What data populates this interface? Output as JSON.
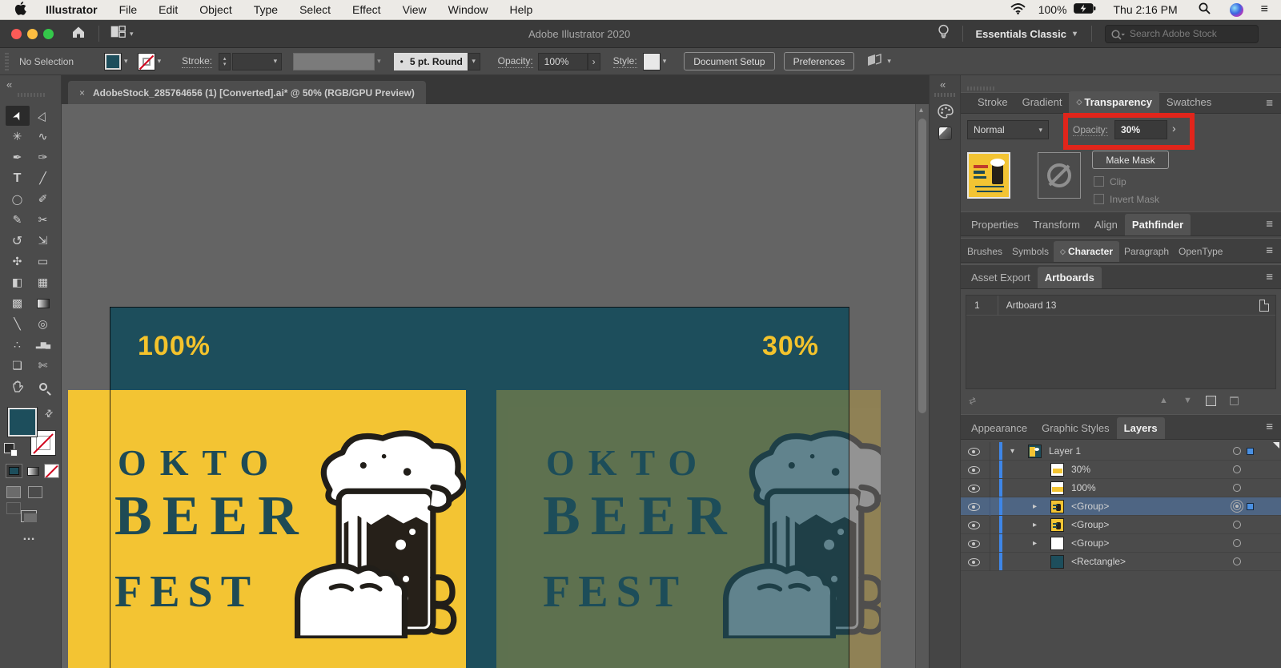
{
  "menubar": {
    "items": [
      "Illustrator",
      "File",
      "Edit",
      "Object",
      "Type",
      "Select",
      "Effect",
      "View",
      "Window",
      "Help"
    ],
    "status": {
      "battery": "100%",
      "clock": "Thu 2:16 PM"
    }
  },
  "titlebar": {
    "title": "Adobe Illustrator 2020",
    "workspace": "Essentials Classic",
    "search_placeholder": "Search Adobe Stock"
  },
  "controlbar": {
    "selection_status": "No Selection",
    "stroke_label": "Stroke:",
    "brush_preview": "5 pt. Round",
    "brush_bullet": "•",
    "opacity_label": "Opacity:",
    "opacity_value": "100%",
    "style_label": "Style:",
    "document_setup": "Document Setup",
    "preferences": "Preferences"
  },
  "document_tab": {
    "close": "×",
    "title": "AdobeStock_285764656 (1) [Converted].ai* @ 50% (RGB/GPU Preview)"
  },
  "tools": [
    {
      "name": "selection-tool",
      "glyph": "➤"
    },
    {
      "name": "direct-selection-tool",
      "glyph": "▷"
    },
    {
      "name": "magic-wand-tool",
      "glyph": "✳"
    },
    {
      "name": "lasso-tool",
      "glyph": "∿"
    },
    {
      "name": "pen-tool",
      "glyph": "✒"
    },
    {
      "name": "curvature-tool",
      "glyph": "✑"
    },
    {
      "name": "type-tool",
      "glyph": "T"
    },
    {
      "name": "line-segment-tool",
      "glyph": "╱"
    },
    {
      "name": "ellipse-tool",
      "glyph": "◯"
    },
    {
      "name": "paintbrush-tool",
      "glyph": "✐"
    },
    {
      "name": "pencil-tool",
      "glyph": "✎"
    },
    {
      "name": "scissors-tool",
      "glyph": "✂"
    },
    {
      "name": "rotate-tool",
      "glyph": "↺"
    },
    {
      "name": "scale-tool",
      "glyph": "⇲"
    },
    {
      "name": "puppet-warp-tool",
      "glyph": "✣"
    },
    {
      "name": "free-transform-tool",
      "glyph": "▭"
    },
    {
      "name": "shape-builder-tool",
      "glyph": "◧"
    },
    {
      "name": "perspective-grid-tool",
      "glyph": "▦"
    },
    {
      "name": "mesh-tool",
      "glyph": "▩"
    },
    {
      "name": "gradient-tool",
      "glyph": ""
    },
    {
      "name": "eyedropper-tool",
      "glyph": "╲"
    },
    {
      "name": "blend-tool",
      "glyph": "◎"
    },
    {
      "name": "symbol-sprayer-tool",
      "glyph": "∴"
    },
    {
      "name": "column-graph-tool",
      "glyph": "▂▆▄"
    },
    {
      "name": "artboard-tool",
      "glyph": "❏"
    },
    {
      "name": "slice-tool",
      "glyph": "✄"
    },
    {
      "name": "hand-tool",
      "glyph": ""
    },
    {
      "name": "zoom-tool",
      "glyph": ""
    }
  ],
  "canvas": {
    "label_left": "100%",
    "label_right": "30%",
    "poster": {
      "line1": "OKTO",
      "line2": "BEER",
      "line3": "FEST"
    }
  },
  "panels": {
    "group1": {
      "tabs": [
        "Stroke",
        "Gradient",
        "Transparency",
        "Swatches"
      ],
      "active": "Transparency"
    },
    "transparency": {
      "blend_mode": "Normal",
      "opacity_label": "Opacity:",
      "opacity_value": "30%",
      "make_mask": "Make Mask",
      "clip": "Clip",
      "invert_mask": "Invert Mask"
    },
    "group2": {
      "tabs": [
        "Properties",
        "Transform",
        "Align",
        "Pathfinder"
      ],
      "active": "Pathfinder"
    },
    "group3": {
      "tabs": [
        "Brushes",
        "Symbols",
        "Character",
        "Paragraph",
        "OpenType"
      ],
      "active": "Character"
    },
    "group4": {
      "tabs": [
        "Asset Export",
        "Artboards"
      ],
      "active": "Artboards"
    },
    "artboards": {
      "rows": [
        {
          "index": "1",
          "name": "Artboard 13"
        }
      ]
    },
    "group5": {
      "tabs": [
        "Appearance",
        "Graphic Styles",
        "Layers"
      ],
      "active": "Layers"
    },
    "layers": {
      "rows": [
        {
          "name": "Layer 1"
        },
        {
          "name": "30%"
        },
        {
          "name": "100%"
        },
        {
          "name": "<Group>"
        },
        {
          "name": "<Group>"
        },
        {
          "name": "<Group>"
        },
        {
          "name": "<Rectangle>"
        }
      ]
    }
  },
  "icons": {
    "panel_menu": "≡",
    "chevron_down": "▾",
    "chevron_up": "▴",
    "chevron_right": "▸",
    "collapse": "«",
    "ellipsis": "…",
    "diamond": "◇",
    "arrow_right": "›",
    "list": "≡"
  },
  "colors": {
    "teal": "#1D4E5C",
    "poster_yellow": "#F3C433",
    "highlight_red": "#E1251B",
    "layer_selection": "#4E6583",
    "layer_bar_blue": "#3E86E8"
  }
}
